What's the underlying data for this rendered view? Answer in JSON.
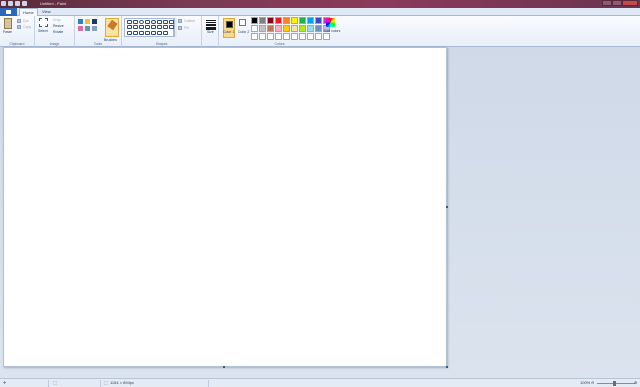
{
  "window": {
    "title": "Untitled - Paint"
  },
  "tabs": [
    {
      "label": "Home"
    },
    {
      "label": "View"
    }
  ],
  "ribbon": {
    "clipboard": {
      "label": "Clipboard",
      "paste": "Paste",
      "cut": "Cut",
      "copy": "Copy"
    },
    "image": {
      "label": "Image",
      "select": "Select",
      "crop": "Crop",
      "resize": "Resize",
      "rotate": "Rotate"
    },
    "tools": {
      "label": "Tools",
      "brushes": "Brushes"
    },
    "shapes": {
      "label": "Shapes",
      "outline": "Outline",
      "fill": "Fill"
    },
    "size": {
      "label": "Size"
    },
    "colors": {
      "label": "Colors",
      "color1": "Color 1",
      "color2": "Color 2",
      "edit_colors": "Edit colors",
      "palette": [
        "#000000",
        "#7f7f7f",
        "#880015",
        "#ed1c24",
        "#ff7f27",
        "#fff200",
        "#22b14c",
        "#00a2e8",
        "#3f48cc",
        "#a349a4",
        "#ffffff",
        "#c3c3c3",
        "#b97a57",
        "#ffaec9",
        "#ffc90e",
        "#efe4b0",
        "#b5e61d",
        "#99d9ea",
        "#7092be",
        "#c8bfe7",
        "#ffffff",
        "#ffffff",
        "#ffffff",
        "#ffffff",
        "#ffffff",
        "#ffffff",
        "#ffffff",
        "#ffffff",
        "#ffffff",
        "#ffffff"
      ]
    }
  },
  "status": {
    "dimensions": "1154 × 894px",
    "zoom": "100%"
  }
}
